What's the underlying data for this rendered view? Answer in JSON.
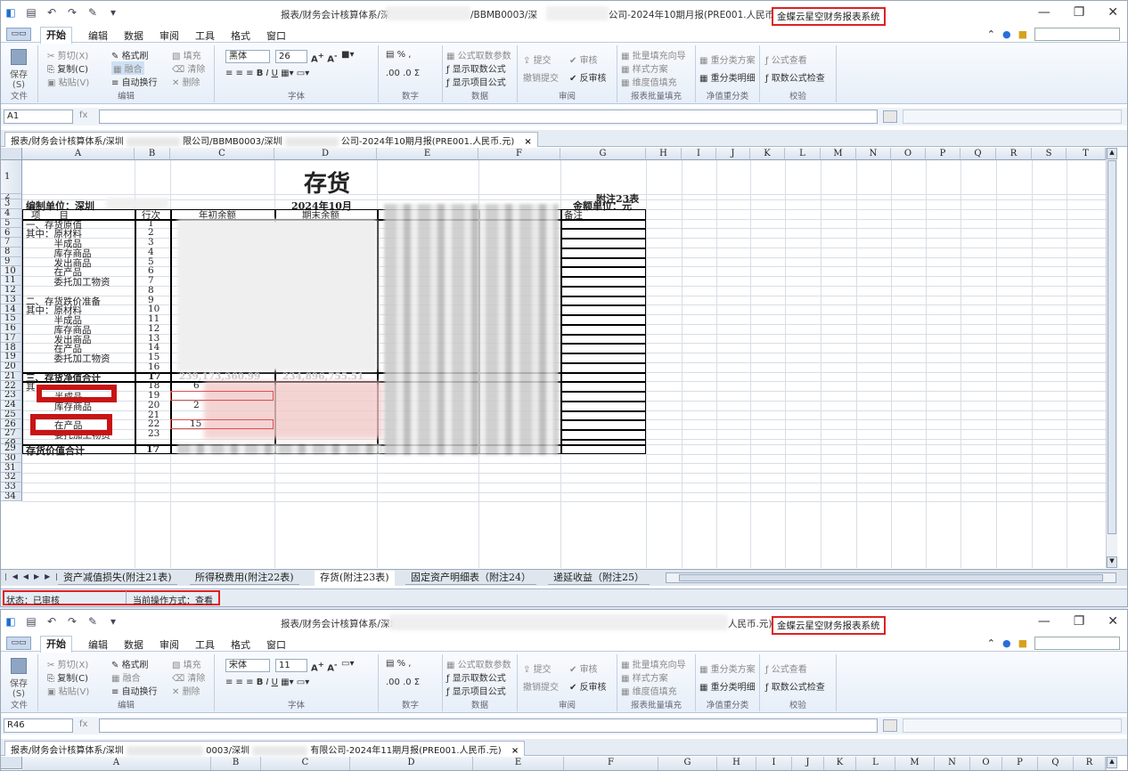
{
  "window1": {
    "title_prefix": "报表/财务会计核算体系/深",
    "title_mid": "/BBMB0003/深",
    "title_suffix": "公司-2024年10期月报(PRE001.人民币.元)",
    "system_name": "金蝶云星空财务报表系统",
    "menus": [
      "开始",
      "编辑",
      "数据",
      "审阅",
      "工具",
      "格式",
      "窗口"
    ],
    "file_menu": "文件",
    "ribbon": {
      "save": "保存(S)",
      "cut": "剪切(X)",
      "copy": "复制(C)",
      "paste": "粘贴(V)",
      "format_painter": "格式刷",
      "merge": "融合",
      "wrap": "自动换行",
      "fill": "填充",
      "clear": "清除",
      "delete": "删除",
      "font_name": "黑体",
      "font_size": "26",
      "formula_params": "公式取数参数",
      "show_formula": "显示取数公式",
      "show_item_formula": "显示项目公式",
      "submit": "提交",
      "audit": "审核",
      "cancel_submit": "撤销提交",
      "unaudit": "反审核",
      "batch_fill_wizard": "批量填充向导",
      "style_scheme": "样式方案",
      "dim_fill": "维度值填充",
      "reclass_scheme": "重分类方案",
      "reclass_detail": "重分类明细",
      "formula_view": "公式查看",
      "formula_check": "取数公式检查",
      "groups": [
        "文件",
        "编辑",
        "字体",
        "数字",
        "数据",
        "审阅",
        "报表批量填充",
        "净值重分类",
        "校验"
      ]
    },
    "name_box": "A1",
    "fx": "fx",
    "doc_tab": "报表/财务会计核算体系/深圳",
    "doc_tab_mid": "限公司/BBMB0003/深圳",
    "doc_tab_end": "公司-2024年10期月报(PRE001.人民币.元)",
    "columns": [
      "A",
      "B",
      "C",
      "D",
      "E",
      "F",
      "G",
      "H",
      "I",
      "J",
      "K",
      "L",
      "M",
      "N",
      "O",
      "P",
      "Q",
      "R",
      "S",
      "T"
    ],
    "rows": [
      "1",
      "2",
      "3",
      "4",
      "5",
      "6",
      "7",
      "8",
      "9",
      "10",
      "11",
      "12",
      "13",
      "14",
      "15",
      "16",
      "17",
      "18",
      "19",
      "20",
      "21",
      "22",
      "23",
      "24",
      "25",
      "26",
      "27",
      "28",
      "29",
      "30",
      "31",
      "32",
      "33",
      "34"
    ],
    "sheet": {
      "title": "存货",
      "note": "附注23表",
      "unit": "金额单位：元",
      "company": "编制单位：深圳",
      "period": "2024年10月",
      "h_item": "项　　目",
      "h_rowno": "行次",
      "h_begin": "年初余额",
      "h_end": "期末余额",
      "h_remark": "备注",
      "items": [
        {
          "label": "一、存货原值",
          "no": "1"
        },
        {
          "label": "其中：原材料",
          "no": "2"
        },
        {
          "label": "　　　半成品",
          "no": "3"
        },
        {
          "label": "　　　库存商品",
          "no": "4"
        },
        {
          "label": "　　　发出商品",
          "no": "5"
        },
        {
          "label": "　　　在产品",
          "no": "6"
        },
        {
          "label": "　　　委托加工物资",
          "no": "7"
        },
        {
          "label": "",
          "no": "8"
        },
        {
          "label": "二、存货跌价准备",
          "no": "9"
        },
        {
          "label": "其中：原材料",
          "no": "10"
        },
        {
          "label": "　　　半成品",
          "no": "11"
        },
        {
          "label": "　　　库存商品",
          "no": "12"
        },
        {
          "label": "　　　发出商品",
          "no": "13"
        },
        {
          "label": "　　　在产品",
          "no": "14"
        },
        {
          "label": "　　　委托加工物资",
          "no": "15"
        },
        {
          "label": "",
          "no": "16"
        },
        {
          "label": "三、存货净值合计",
          "no": "17"
        },
        {
          "label": "其",
          "no": "18"
        },
        {
          "label": "半成品",
          "no": "19"
        },
        {
          "label": "库存商品",
          "no": "20"
        },
        {
          "label": "",
          "no": "21"
        },
        {
          "label": "在产品",
          "no": "22"
        },
        {
          "label": "委托加工物资",
          "no": "23"
        }
      ],
      "row21_begin": "239,173,360.99",
      "row21_end": "234,896,755.51",
      "row22_partial": "6",
      "row24_partial": "2",
      "row26_partial": "15",
      "total_label": "存货价值合计",
      "total_no": "17"
    },
    "sheet_tabs": [
      "资产减值损失(附注21表)",
      "所得税费用(附注22表)",
      "存货(附注23表)",
      "固定资产明细表（附注24）",
      "递延收益（附注25）"
    ],
    "status": "状态：已审核",
    "operation": "当前操作方式：查看"
  },
  "window2": {
    "title_prefix": "报表/财务会计核算体系/深圳",
    "title_suffix": "人民币.元)",
    "system_name": "金蝶云星空财务报表系统",
    "font_name": "宋体",
    "font_size": "11",
    "name_box": "R46",
    "doc_tab": "报表/财务会计核算体系/深圳",
    "doc_tab_mid": "0003/深圳",
    "doc_tab_end": "有限公司-2024年11期月报(PRE001.人民币.元)",
    "columns": [
      "A",
      "B",
      "C",
      "D",
      "E",
      "F",
      "G",
      "H",
      "I",
      "J",
      "K",
      "L",
      "M",
      "N",
      "O",
      "P",
      "Q",
      "R"
    ]
  }
}
